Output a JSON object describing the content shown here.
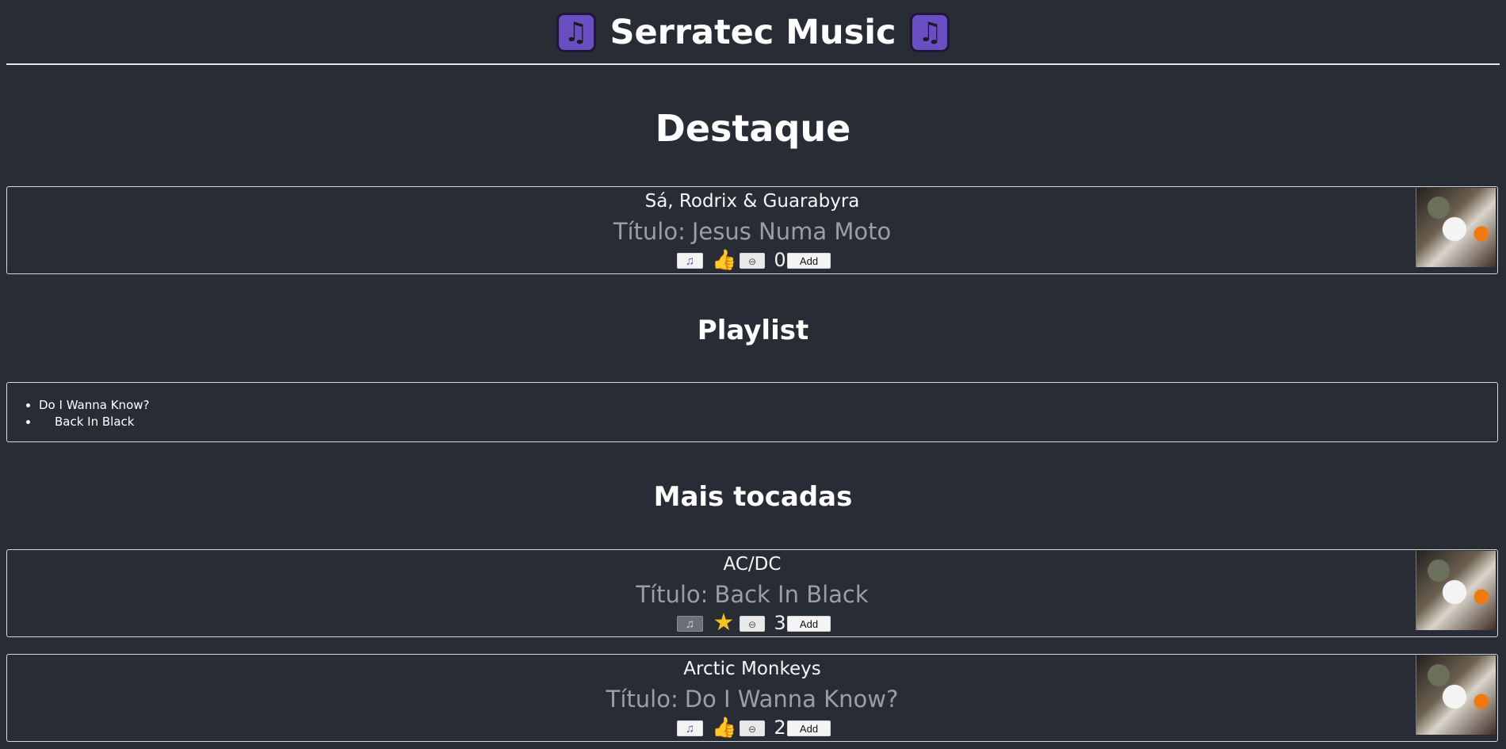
{
  "app": {
    "title": "Serratec Music",
    "icon": "music-note-icon"
  },
  "sections": {
    "featured": "Destaque",
    "playlist": "Playlist",
    "most_played": "Mais tocadas"
  },
  "featured": {
    "artist": "Sá, Rodrix & Guarabyra",
    "title_prefix": "Título:",
    "title": "Jesus Numa Moto",
    "reaction": "thumbs-up-icon",
    "count": "0",
    "add_label": "Add"
  },
  "playlist": {
    "items": [
      "Do I Wanna Know?",
      "Back In Black"
    ]
  },
  "most_played": [
    {
      "artist": "AC/DC",
      "title_prefix": "Título:",
      "title": "Back In Black",
      "reaction": "star-icon",
      "count": "3",
      "add_label": "Add",
      "play_state": "disabled"
    },
    {
      "artist": "Arctic Monkeys",
      "title_prefix": "Título:",
      "title": "Do I Wanna Know?",
      "reaction": "thumbs-up-icon",
      "count": "2",
      "add_label": "Add",
      "play_state": "enabled"
    }
  ],
  "colors": {
    "background": "#282c34",
    "text": "#ffffff",
    "muted_title": "#9a9ea8",
    "border": "#d8d8d8",
    "accent_purple": "#6a4fc3",
    "star": "#f4c21f"
  }
}
